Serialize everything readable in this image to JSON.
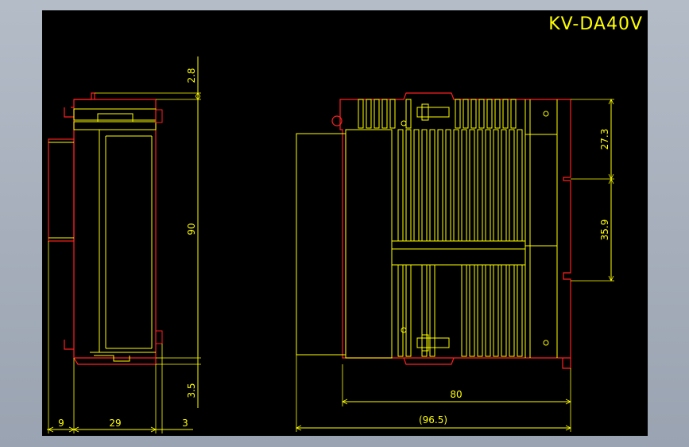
{
  "title": "KV-DA40V",
  "colors": {
    "background_outer": "#a7afbc",
    "canvas": "#000000",
    "outline": "#ff2020",
    "detail": "#ffff00",
    "dimension": "#ffff00"
  },
  "dimensions": {
    "top_gap": "2.8",
    "height": "90",
    "bottom_gap": "3.5",
    "left_width": "9",
    "body_width": "29",
    "right_width": "3",
    "upper_right": "27.3",
    "lower_right": "35.9",
    "depth": "80",
    "total_depth": "(96.5)"
  }
}
